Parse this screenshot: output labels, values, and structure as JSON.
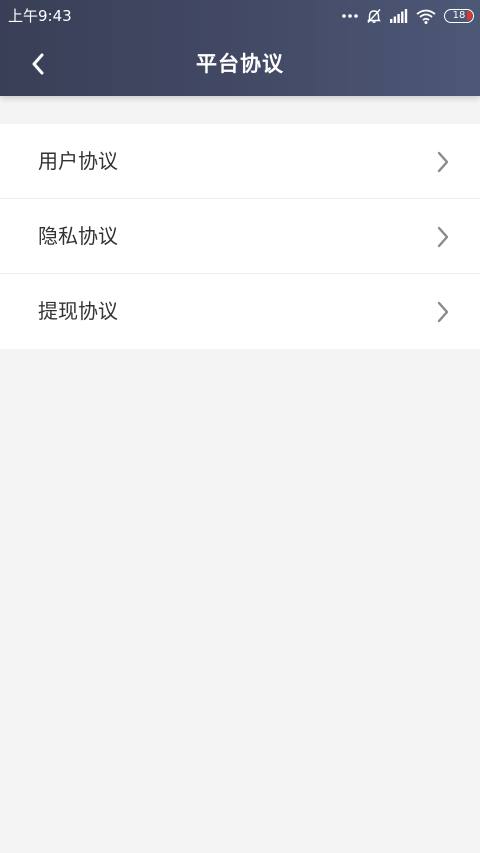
{
  "status_bar": {
    "time": "上午9:43",
    "battery_level": "18",
    "icons": [
      "more-dots-icon",
      "alarm-off-icon",
      "signal-icon",
      "wifi-icon",
      "battery-icon"
    ]
  },
  "header": {
    "title": "平台协议",
    "back_icon": "chevron-left-icon"
  },
  "agreements": {
    "items": [
      {
        "label": "用户协议",
        "icon": "chevron-right-icon"
      },
      {
        "label": "隐私协议",
        "icon": "chevron-right-icon"
      },
      {
        "label": "提现协议",
        "icon": "chevron-right-icon"
      }
    ]
  },
  "colors": {
    "header_start": "#3a3f57",
    "header_end": "#4d5877",
    "page_background": "#f4f4f4",
    "item_text": "#333333",
    "chevron": "#8a8a8a",
    "battery_low": "#e0352b"
  }
}
